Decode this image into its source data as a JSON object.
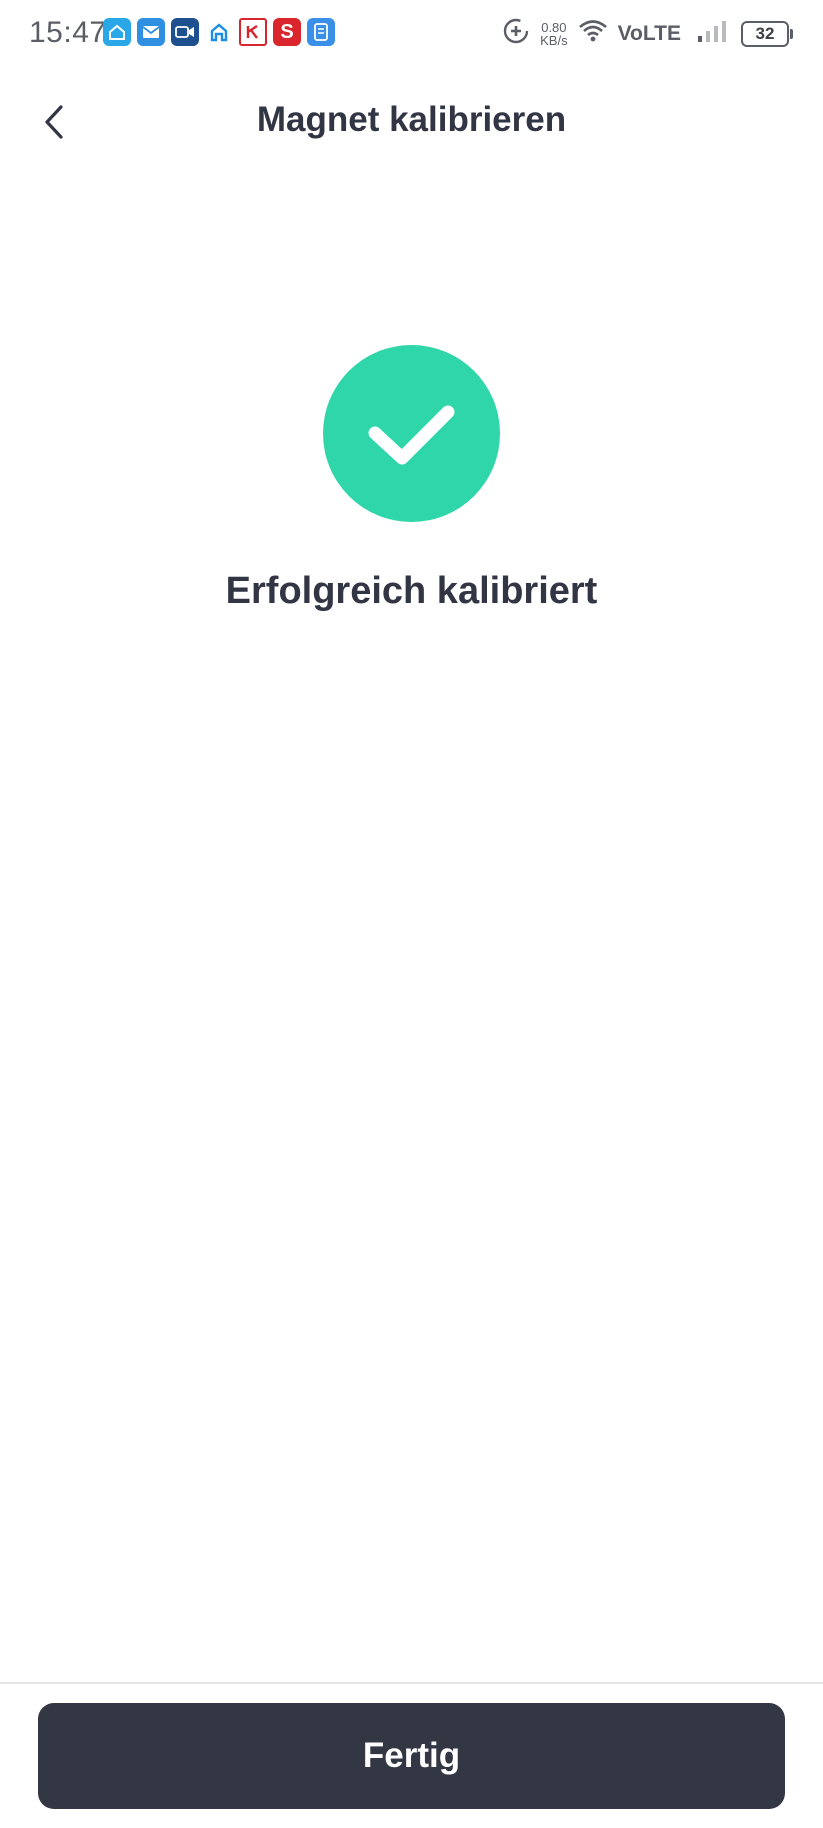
{
  "status_bar": {
    "time": "15:47",
    "network_speed_value": "0.80",
    "network_speed_unit": "KB/s",
    "network_type": "VoLTE",
    "battery": "32",
    "notification_icons": [
      {
        "name": "home-app-icon",
        "color": "#2aa7e6"
      },
      {
        "name": "mail-app-icon",
        "color": "#2f8fe0"
      },
      {
        "name": "video-call-icon",
        "color": "#1e4f8f"
      },
      {
        "name": "home-outline-icon",
        "color": "#1a8fe3"
      },
      {
        "name": "kaufland-icon",
        "color": "#d9252b"
      },
      {
        "name": "s-app-icon",
        "color": "#d9252b"
      },
      {
        "name": "scan-app-icon",
        "color": "#3a8fe8"
      }
    ]
  },
  "header": {
    "title": "Magnet kalibrieren",
    "back_icon": "chevron-left-icon"
  },
  "main": {
    "success_icon": "checkmark-icon",
    "success_color": "#2fd6a9",
    "message": "Erfolgreich kalibriert"
  },
  "footer": {
    "done_label": "Fertig",
    "button_color": "#333643"
  }
}
